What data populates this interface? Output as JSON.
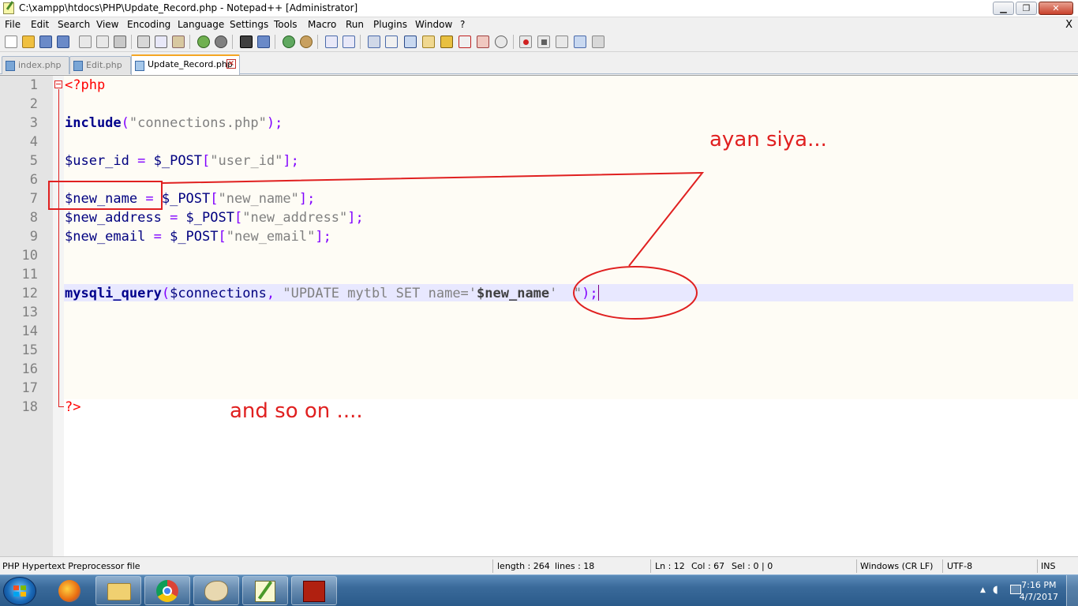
{
  "window": {
    "title": "C:\\xampp\\htdocs\\PHP\\Update_Record.php - Notepad++ [Administrator]",
    "minimize_glyph": "▁",
    "maximize_glyph": "❐",
    "close_glyph": "✕"
  },
  "menu": {
    "items": [
      "File",
      "Edit",
      "Search",
      "View",
      "Encoding",
      "Language",
      "Settings",
      "Tools",
      "Macro",
      "Run",
      "Plugins",
      "Window",
      "?"
    ],
    "close_label": "X"
  },
  "tabs": [
    {
      "label": "index.php",
      "active": false
    },
    {
      "label": "Edit.php",
      "active": false
    },
    {
      "label": "Update_Record.php",
      "active": true
    }
  ],
  "editor": {
    "line_numbers": [
      "1",
      "2",
      "3",
      "4",
      "5",
      "6",
      "7",
      "8",
      "9",
      "10",
      "11",
      "12",
      "13",
      "14",
      "15",
      "16",
      "17",
      "18"
    ],
    "lines": {
      "l1_open": "<?php",
      "l3_kw": "include",
      "l3_p1": "(",
      "l3_str": "\"connections.php\"",
      "l3_p2": ");",
      "l5_var": "$user_id",
      "l5_eq": " = ",
      "l5_post": "$_POST",
      "l5_b1": "[",
      "l5_str": "\"user_id\"",
      "l5_b2": "];",
      "l7_var": "$new_name",
      "l7_eq": " = ",
      "l7_post": "$_POST",
      "l7_b1": "[",
      "l7_str": "\"new_name\"",
      "l7_b2": "];",
      "l8_var": "$new_address",
      "l8_eq": " = ",
      "l8_post": "$_POST",
      "l8_b1": "[",
      "l8_str": "\"new_address\"",
      "l8_b2": "];",
      "l9_var": "$new_email",
      "l9_eq": " = ",
      "l9_post": "$_POST",
      "l9_b1": "[",
      "l9_str": "\"new_email\"",
      "l9_b2": "];",
      "l12_kw": "mysqli_query",
      "l12_p1": "(",
      "l12_var": "$connections",
      "l12_comma": ", ",
      "l12_str1": "\"UPDATE mytbl SET name='",
      "l12_inner": "$new_name",
      "l12_str2": "'  \"",
      "l12_p2": ");",
      "l18_close": "?>"
    },
    "current_line": 12
  },
  "annotations": {
    "ayan": "ayan siya...",
    "andso": "and so on ....",
    "color": "#e02020"
  },
  "statusbar": {
    "filetype": "PHP Hypertext Preprocessor file",
    "length": "length : 264",
    "lines": "lines : 18",
    "ln": "Ln : 12",
    "col": "Col : 67",
    "sel": "Sel : 0 | 0",
    "eol": "Windows (CR LF)",
    "encoding": "UTF-8",
    "mode": "INS"
  },
  "taskbar": {
    "apps": [
      "firefox-icon",
      "explorer-icon",
      "chrome-icon",
      "paint-icon",
      "notepadpp-icon",
      "dota2-icon"
    ],
    "time": "7:16 PM",
    "date": "4/7/2017"
  }
}
